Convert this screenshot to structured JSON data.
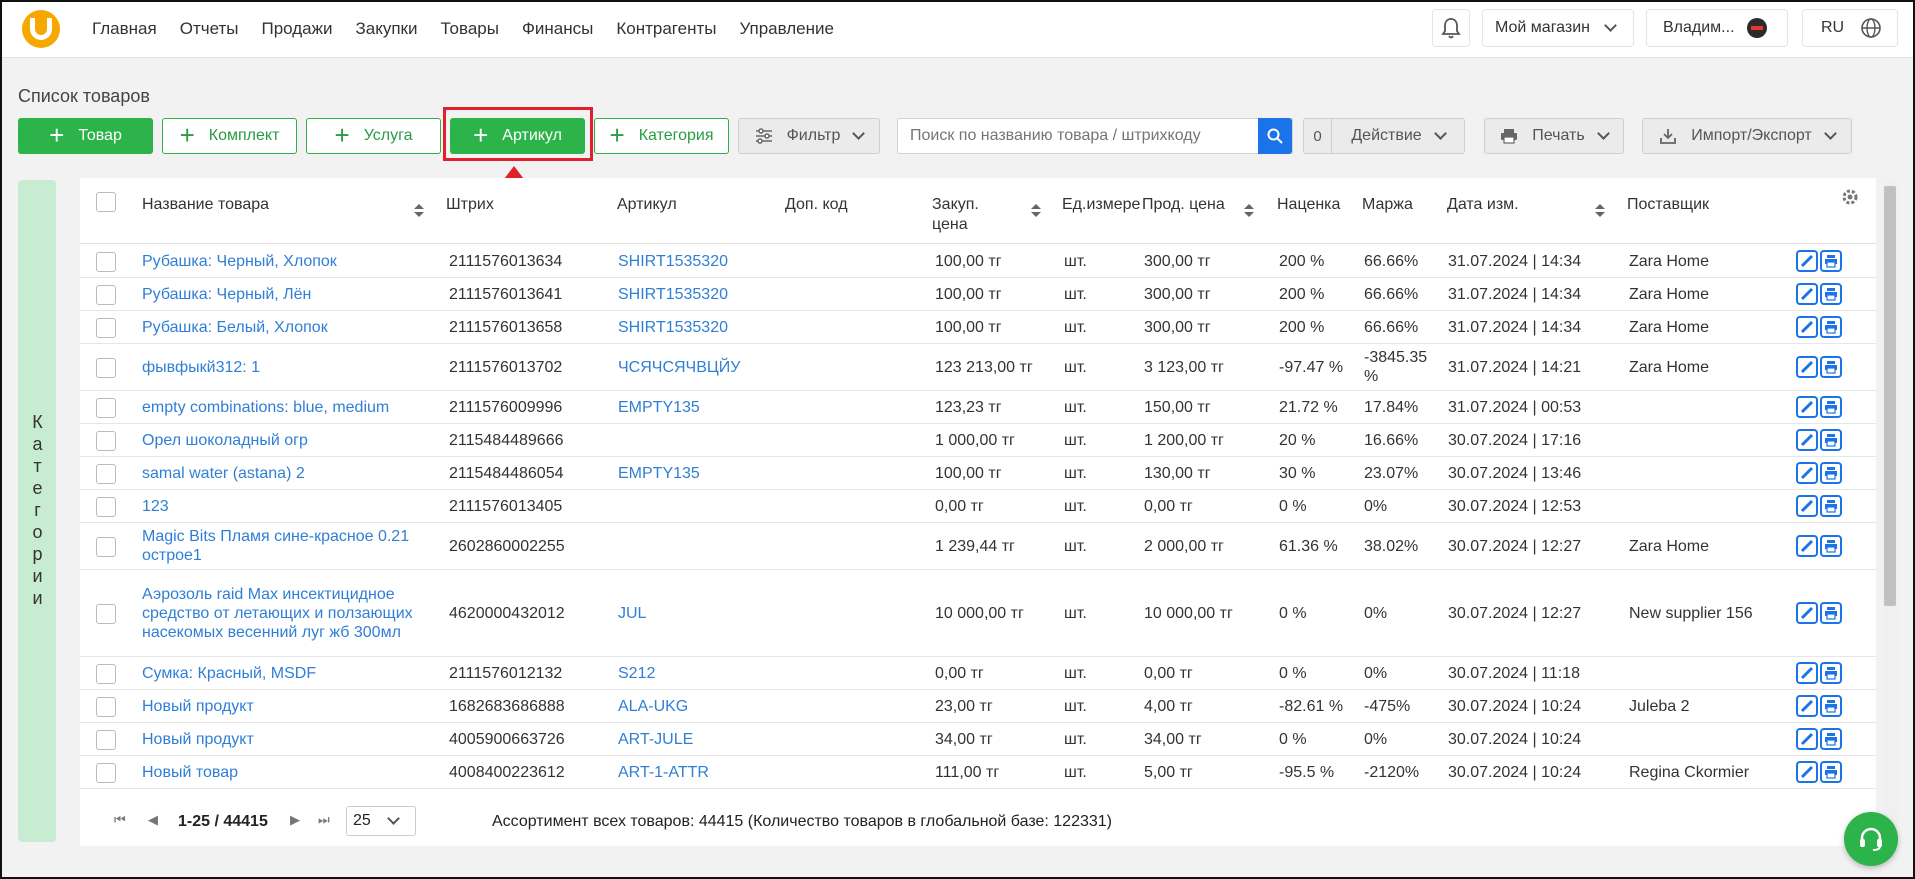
{
  "nav": {
    "items": [
      "Главная",
      "Отчеты",
      "Продажи",
      "Закупки",
      "Товары",
      "Финансы",
      "Контрагенты",
      "Управление"
    ]
  },
  "topbar": {
    "store": "Мой магазин",
    "user": "Владим...",
    "lang": "RU"
  },
  "page_title": "Список товаров",
  "toolbar": {
    "product": "Товар",
    "kit": "Комплект",
    "service": "Услуга",
    "article": "Артикул",
    "category": "Категория",
    "filter": "Фильтр",
    "search_placeholder": "Поиск по названию товара / штрихкоду",
    "count": "0",
    "action": "Действие",
    "print": "Печать",
    "import_export": "Импорт/Экспорт"
  },
  "categories_label": "Категории",
  "table": {
    "headers": {
      "name": "Название товара",
      "barcode": "Штрих",
      "article": "Артикул",
      "extra_code": "Доп. код",
      "purchase_price": "Закуп. цена",
      "unit": "Ед.измере",
      "sale_price": "Прод. цена",
      "markup": "Наценка",
      "margin": "Маржа",
      "date": "Дата изм.",
      "supplier": "Поставщик"
    },
    "rows": [
      {
        "name": "Рубашка: Черный, Хлопок",
        "barcode": "2111576013634",
        "article": "SHIRT1535320",
        "extra": "",
        "purchase": "100,00 тг",
        "unit": "шт.",
        "sale": "300,00 тг",
        "markup": "200 %",
        "margin": "66.66%",
        "date": "31.07.2024 | 14:34",
        "supplier": "Zara Home"
      },
      {
        "name": "Рубашка: Черный, Лён",
        "barcode": "2111576013641",
        "article": "SHIRT1535320",
        "extra": "",
        "purchase": "100,00 тг",
        "unit": "шт.",
        "sale": "300,00 тг",
        "markup": "200 %",
        "margin": "66.66%",
        "date": "31.07.2024 | 14:34",
        "supplier": "Zara Home"
      },
      {
        "name": "Рубашка: Белый, Хлопок",
        "barcode": "2111576013658",
        "article": "SHIRT1535320",
        "extra": "",
        "purchase": "100,00 тг",
        "unit": "шт.",
        "sale": "300,00 тг",
        "markup": "200 %",
        "margin": "66.66%",
        "date": "31.07.2024 | 14:34",
        "supplier": "Zara Home"
      },
      {
        "name": "фывфыкй312: 1",
        "barcode": "2111576013702",
        "article": "ЧСЯЧСЯЧВЦЙУ",
        "extra": "",
        "purchase": "123 213,00 тг",
        "unit": "шт.",
        "sale": "3 123,00 тг",
        "markup": "-97.47 %",
        "margin": "-3845.35 %",
        "date": "31.07.2024 | 14:21",
        "supplier": "Zara Home"
      },
      {
        "name": "empty combinations: blue, medium",
        "barcode": "2111576009996",
        "article": "EMPTY135",
        "extra": "",
        "purchase": "123,23 тг",
        "unit": "шт.",
        "sale": "150,00 тг",
        "markup": "21.72 %",
        "margin": "17.84%",
        "date": "31.07.2024 | 00:53",
        "supplier": ""
      },
      {
        "name": "Орел шоколадный огр",
        "barcode": "2115484489666",
        "article": "",
        "extra": "",
        "purchase": "1 000,00 тг",
        "unit": "шт.",
        "sale": "1 200,00 тг",
        "markup": "20 %",
        "margin": "16.66%",
        "date": "30.07.2024 | 17:16",
        "supplier": ""
      },
      {
        "name": "samal water (astana) 2",
        "barcode": "2115484486054",
        "article": "EMPTY135",
        "extra": "",
        "purchase": "100,00 тг",
        "unit": "шт.",
        "sale": "130,00 тг",
        "markup": "30 %",
        "margin": "23.07%",
        "date": "30.07.2024 | 13:46",
        "supplier": ""
      },
      {
        "name": "123",
        "barcode": "2111576013405",
        "article": "",
        "extra": "",
        "purchase": "0,00 тг",
        "unit": "шт.",
        "sale": "0,00 тг",
        "markup": "0 %",
        "margin": "0%",
        "date": "30.07.2024 | 12:53",
        "supplier": ""
      },
      {
        "name": "Magic Bits Пламя сине-красное 0.21 острое1",
        "barcode": "2602860002255",
        "article": "",
        "extra": "",
        "purchase": "1 239,44 тг",
        "unit": "шт.",
        "sale": "2 000,00 тг",
        "markup": "61.36 %",
        "margin": "38.02%",
        "date": "30.07.2024 | 12:27",
        "supplier": "Zara Home"
      },
      {
        "name": "Аэрозоль raid Max инсектицидное средство от летающих и ползающих насекомых весенний луг жб 300мл",
        "barcode": "4620000432012",
        "article": "JUL",
        "extra": "",
        "purchase": "10 000,00 тг",
        "unit": "шт.",
        "sale": "10 000,00 тг",
        "markup": "0 %",
        "margin": "0%",
        "date": "30.07.2024 | 12:27",
        "supplier": "New supplier 156"
      },
      {
        "name": "Сумка: Красный, MSDF",
        "barcode": "2111576012132",
        "article": "S212",
        "extra": "",
        "purchase": "0,00 тг",
        "unit": "шт.",
        "sale": "0,00 тг",
        "markup": "0 %",
        "margin": "0%",
        "date": "30.07.2024 | 11:18",
        "supplier": ""
      },
      {
        "name": "Новый продукт",
        "barcode": "1682683686888",
        "article": "ALA-UKG",
        "extra": "",
        "purchase": "23,00 тг",
        "unit": "шт.",
        "sale": "4,00 тг",
        "markup": "-82.61 %",
        "margin": "-475%",
        "date": "30.07.2024 | 10:24",
        "supplier": "Juleba 2"
      },
      {
        "name": "Новый продукт",
        "barcode": "4005900663726",
        "article": "ART-JULE",
        "extra": "",
        "purchase": "34,00 тг",
        "unit": "шт.",
        "sale": "34,00 тг",
        "markup": "0 %",
        "margin": "0%",
        "date": "30.07.2024 | 10:24",
        "supplier": ""
      },
      {
        "name": "Новый товар",
        "barcode": "4008400223612",
        "article": "ART-1-ATTR",
        "extra": "",
        "purchase": "111,00 тг",
        "unit": "шт.",
        "sale": "5,00 тг",
        "markup": "-95.5 %",
        "margin": "-2120%",
        "date": "30.07.2024 | 10:24",
        "supplier": "Regina Ckormier"
      }
    ]
  },
  "footer": {
    "range": "1-25 / 44415",
    "page_size": "25",
    "summary": "Ассортимент всех товаров: 44415 (Количество товаров в глобальной базе: 122331)"
  }
}
